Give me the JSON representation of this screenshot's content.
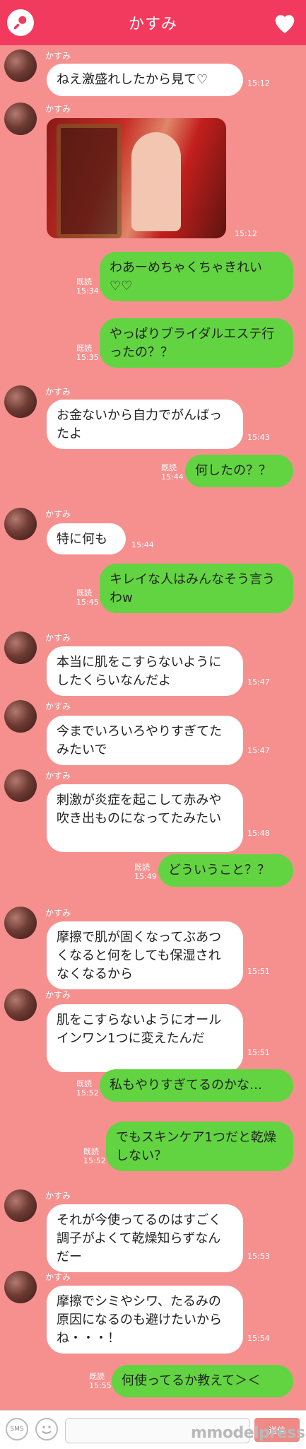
{
  "header": {
    "title": "かすみ"
  },
  "messages": [
    {
      "type": "in",
      "sender": "かすみ",
      "text": "ねえ激盛れしたから見て♡",
      "time": "15:12"
    },
    {
      "type": "in-image",
      "sender": "かすみ",
      "time": "15:12"
    },
    {
      "type": "out",
      "read": "既読",
      "time": "15:34",
      "text": "わあーめちゃくちゃきれい♡♡"
    },
    {
      "type": "out",
      "read": "既読",
      "time": "15:35",
      "text": "やっぱりブライダルエステ行ったの？？"
    },
    {
      "type": "in",
      "sender": "かすみ",
      "text": "お金ないから自力でがんばったよ",
      "time": "15:43"
    },
    {
      "type": "out",
      "read": "既読",
      "time": "15:44",
      "text": "何したの？？"
    },
    {
      "type": "in",
      "sender": "かすみ",
      "text": "特に何も",
      "time": "15:44"
    },
    {
      "type": "out",
      "read": "既読",
      "time": "15:45",
      "text": "キレイな人はみんなそう言うわw"
    },
    {
      "type": "in",
      "sender": "かすみ",
      "text": "本当に肌をこすらないようにしたくらいなんだよ",
      "time": "15:47"
    },
    {
      "type": "in",
      "sender": "かすみ",
      "text": "今までいろいろやりすぎてたみたいで",
      "time": "15:47"
    },
    {
      "type": "in",
      "sender": "かすみ",
      "text": "刺激が炎症を起こして赤みや吹き出ものになってたみたい",
      "time": "15:48"
    },
    {
      "type": "out",
      "read": "既読",
      "time": "15:49",
      "text": "どういうこと？？"
    },
    {
      "type": "in",
      "sender": "かすみ",
      "text": "摩擦で肌が固くなってぶあつくなると何をしても保湿されなくなるから",
      "time": "15:51"
    },
    {
      "type": "in",
      "sender": "かすみ",
      "text": "肌をこすらないようにオールインワン1つに変えたんだ",
      "time": "15:51"
    },
    {
      "type": "out",
      "read": "既読",
      "time": "15:52",
      "text": "私もやりすぎてるのかな…"
    },
    {
      "type": "out",
      "read": "既読",
      "time": "15:52",
      "text": "でもスキンケア1つだと乾燥しない？"
    },
    {
      "type": "in",
      "sender": "かすみ",
      "text": "それが今使ってるのはすごく調子がよくて乾燥知らずなんだー",
      "time": "15:53"
    },
    {
      "type": "in",
      "sender": "かすみ",
      "text": "摩擦でシミやシワ、たるみの原因になるのも避けたいからね・・・！",
      "time": "15:54"
    },
    {
      "type": "out",
      "read": "既読",
      "time": "15:55",
      "text": "何使ってるか教えて＞＜"
    }
  ],
  "footer": {
    "sms_label": "SMS",
    "send_label": "送信"
  },
  "watermark": "mmodelpress",
  "colors": {
    "header": "#f23a5e",
    "background": "#f5908f",
    "outgoing": "#62d441",
    "incoming": "#ffffff"
  }
}
